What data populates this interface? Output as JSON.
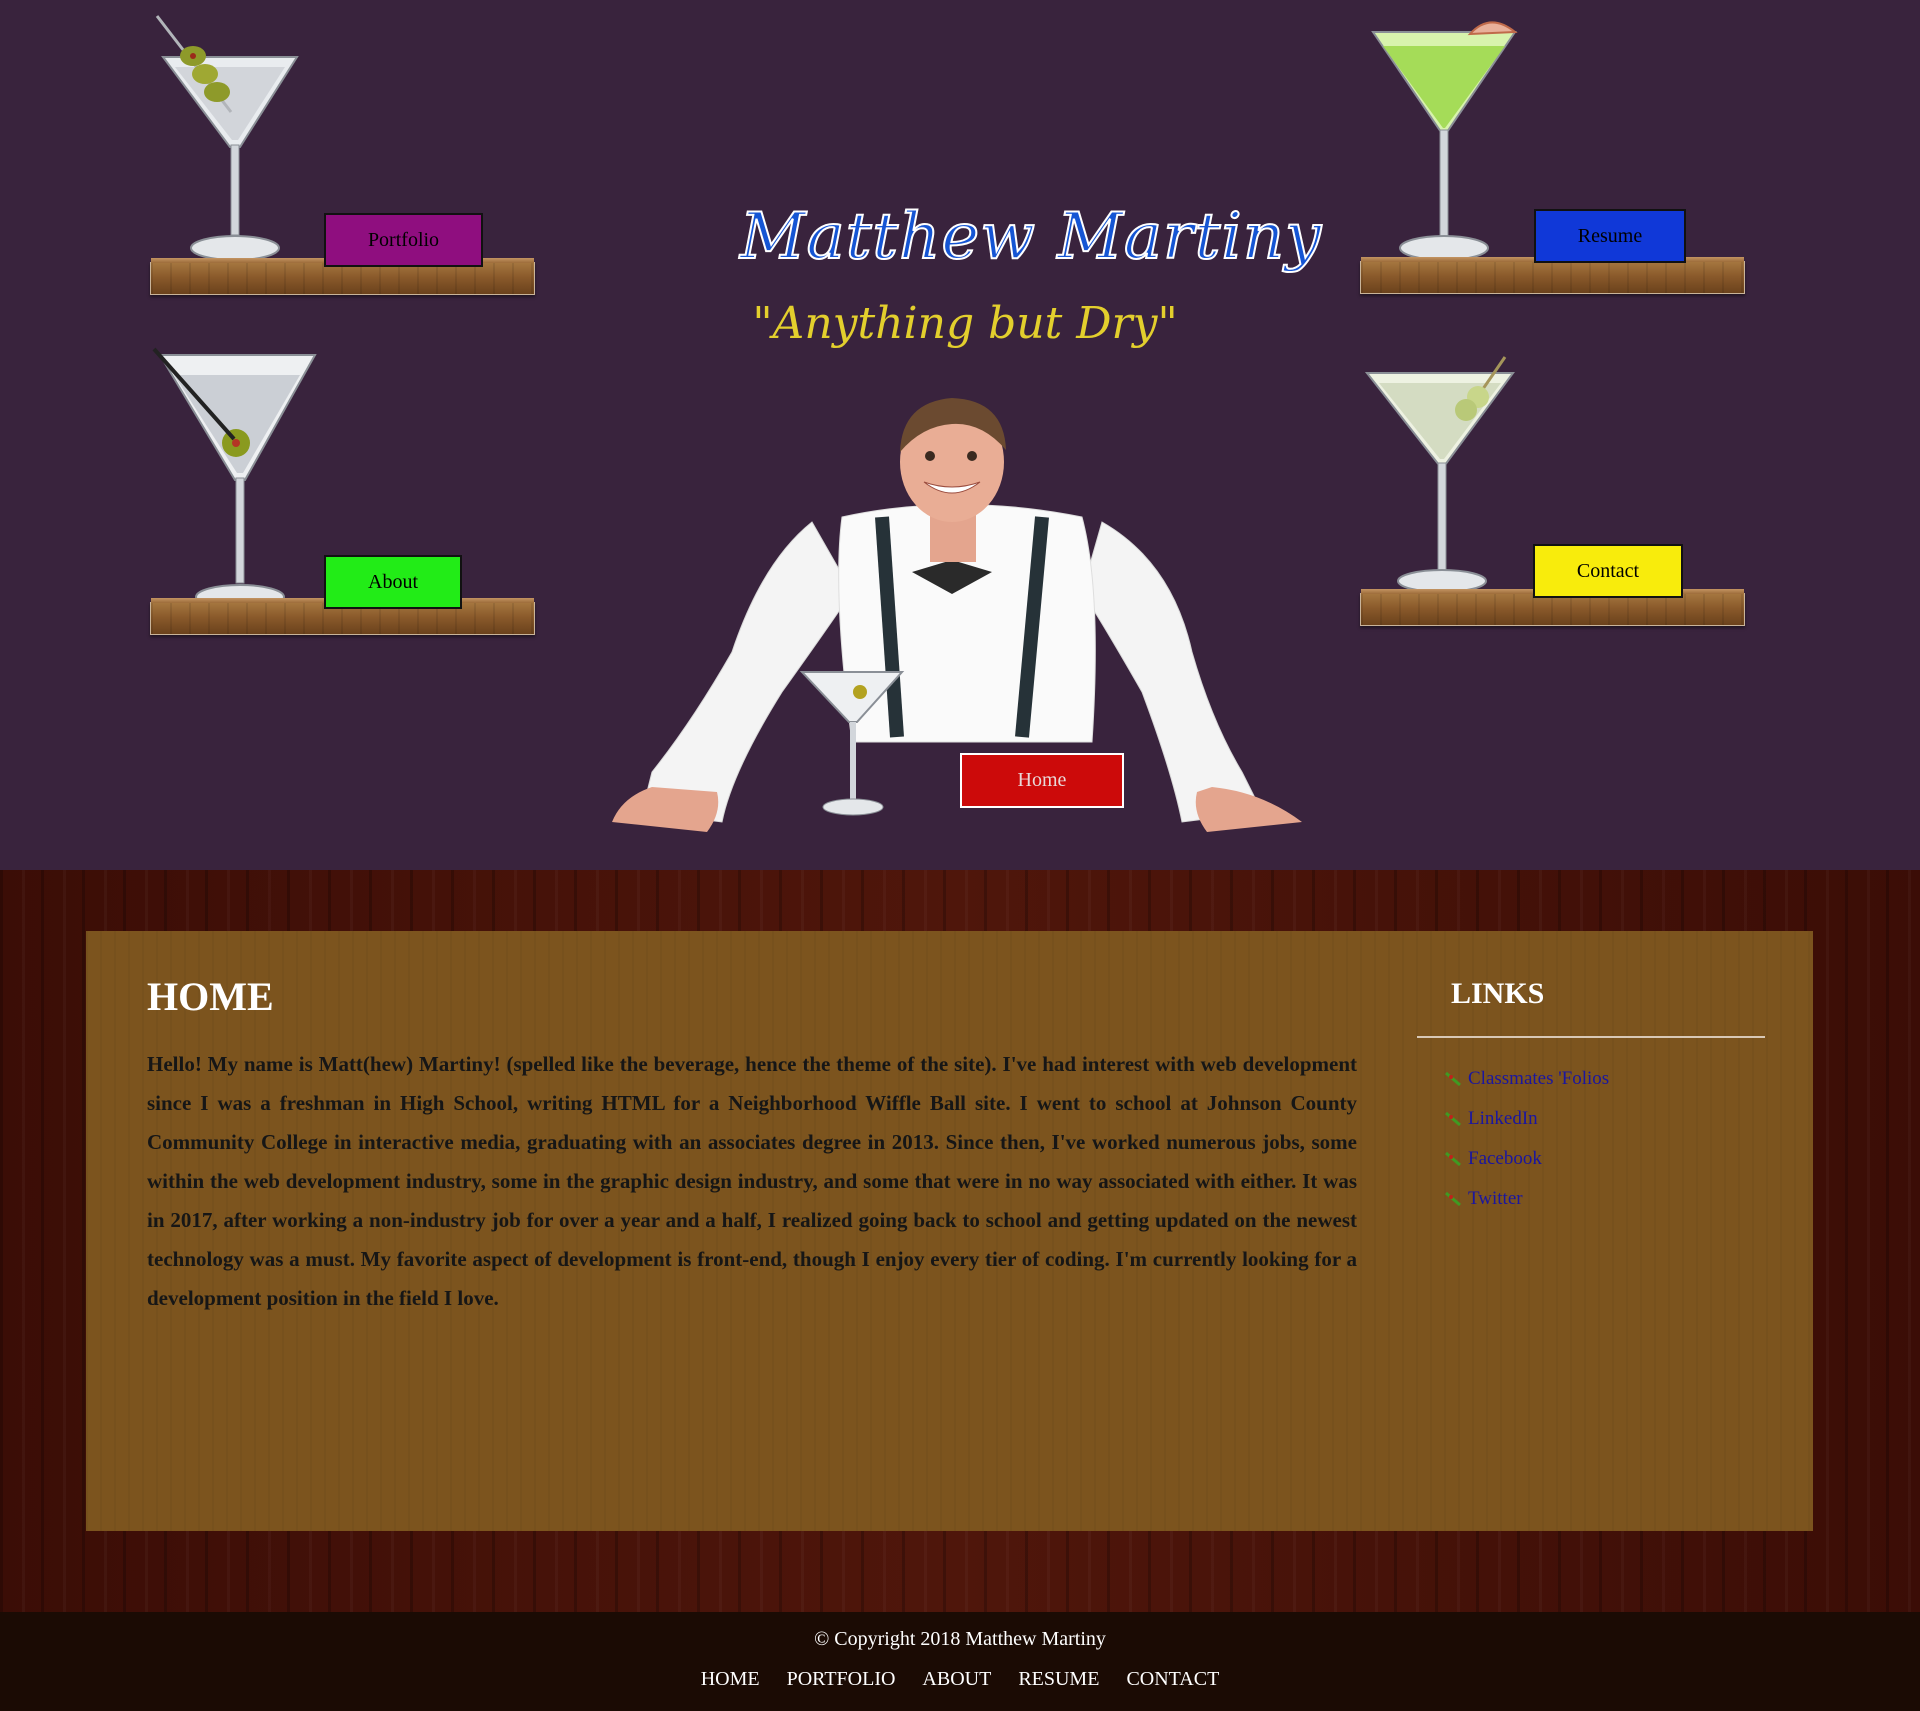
{
  "header": {
    "name": "Matthew Martiny",
    "tagline": "\"Anything but Dry\"",
    "nav": {
      "portfolio": "Portfolio",
      "resume": "Resume",
      "about": "About",
      "contact": "Contact",
      "home": "Home"
    },
    "colors": {
      "portfolio": "#8f0e7f",
      "resume": "#1038d8",
      "about": "#22ec17",
      "contact": "#f8ec0c",
      "home": "#cc0a0a"
    }
  },
  "main": {
    "heading": "HOME",
    "paragraph": "Hello! My name is Matt(hew) Martiny! (spelled like the beverage, hence the theme of the site). I've had interest with web development since I was a freshman in High School, writing HTML for a Neighborhood Wiffle Ball site. I went to school at Johnson County Community College in interactive media, graduating with an associates degree in 2013. Since then, I've worked numerous jobs, some within the web development industry, some in the graphic design industry, and some that were in no way associated with either. It was in 2017, after working a non-industry job for over a year and a half, I realized going back to school and getting updated on the newest technology was a must. My favorite aspect of development is front-end, though I enjoy every tier of coding. I'm currently looking for a development position in the field I love.",
    "links_heading": "LINKS",
    "links": [
      "Classmates 'Folios",
      "LinkedIn",
      "Facebook",
      "Twitter"
    ],
    "link_bullet_icon": "martini-pick-icon"
  },
  "footer": {
    "copyright": "© Copyright 2018 Matthew Martiny",
    "nav": [
      "HOME",
      "PORTFOLIO",
      "ABOUT",
      "RESUME",
      "CONTACT"
    ]
  }
}
